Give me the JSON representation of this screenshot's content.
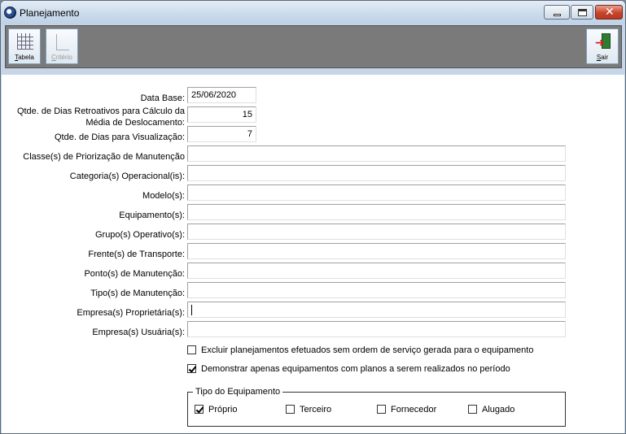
{
  "window": {
    "title": "Planejamento",
    "icon": "app-orb-icon",
    "controls": [
      "minimize-icon",
      "maximize-icon",
      "close-icon"
    ]
  },
  "toolbar": {
    "tabela_first": "T",
    "tabela_rest": "abela",
    "criterio_first": "C",
    "criterio_rest": "ritério",
    "sair_first": "S",
    "sair_rest": "air"
  },
  "form": {
    "data_base_label": "Data Base:",
    "data_base_value": "25/06/2020",
    "dias_retro_label_1": "Qtde. de Dias Retroativos para Cálculo da",
    "dias_retro_label_2": "Média de Deslocamento:",
    "dias_retro_value": "15",
    "dias_vis_label": "Qtde. de Dias para Visualização:",
    "dias_vis_value": "7",
    "classe_label": "Classe(s) de Priorização de Manutenção",
    "categoria_label": "Categoria(s) Operacional(is):",
    "modelo_label": "Modelo(s):",
    "equipamento_label": "Equipamento(s):",
    "grupo_label": "Grupo(s) Operativo(s):",
    "frente_label": "Frente(s) de Transporte:",
    "ponto_label": "Ponto(s) de Manutenção:",
    "tipo_label": "Tipo(s) de Manutenção:",
    "empresa_prop_label": "Empresa(s) Proprietária(s):",
    "empresa_usu_label": "Empresa(s) Usuária(s):"
  },
  "options": {
    "excluir_label": "Excluir planejamentos efetuados sem ordem de serviço gerada para o equipamento",
    "excluir_checked": false,
    "demonstrar_label": "Demonstrar apenas equipamentos com planos a serem realizados no período",
    "demonstrar_checked": true
  },
  "tipo_equipamento": {
    "title": "Tipo do Equipamento",
    "proprio": "Próprio",
    "terceiro": "Terceiro",
    "fornecedor": "Fornecedor",
    "alugado": "Alugado",
    "proprio_checked": true,
    "terceiro_checked": false,
    "fornecedor_checked": false,
    "alugado_checked": false
  }
}
